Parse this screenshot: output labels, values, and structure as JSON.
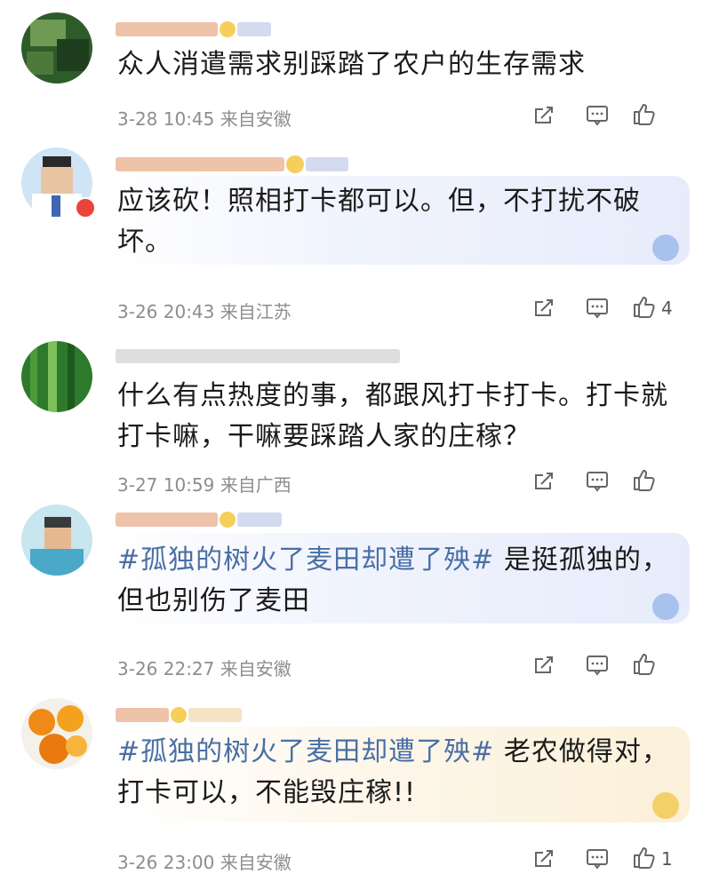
{
  "comments": [
    {
      "text": "众人消遣需求别踩踏了农户的生存需求",
      "hashtag": "",
      "date": "3-28 10:45",
      "location": "来自安徽",
      "likes": ""
    },
    {
      "text": "应该砍！照相打卡都可以。但，不打扰不破坏。",
      "hashtag": "",
      "date": "3-26 20:43",
      "location": "来自江苏",
      "likes": "4"
    },
    {
      "text": "什么有点热度的事，都跟风打卡打卡。打卡就打卡嘛，干嘛要踩踏人家的庄稼？",
      "hashtag": "",
      "date": "3-27 10:59",
      "location": "来自广西",
      "likes": ""
    },
    {
      "text": "是挺孤独的，但也别伤了麦田",
      "hashtag": "#孤独的树火了麦田却遭了殃#",
      "date": "3-26 22:27",
      "location": "来自安徽",
      "likes": ""
    },
    {
      "text": "老农做得对，打卡可以，不能毁庄稼!!",
      "hashtag": "#孤独的树火了麦田却遭了殃#",
      "date": "3-26 23:00",
      "location": "来自安徽",
      "likes": "1"
    }
  ],
  "icons": {
    "share": "share-icon",
    "comment": "comment-icon",
    "like": "thumbs-up-icon"
  },
  "colors": {
    "hashtag": "#4a6fa5",
    "meta": "#8d8d8d",
    "blurred_name": "#e9b98f"
  }
}
